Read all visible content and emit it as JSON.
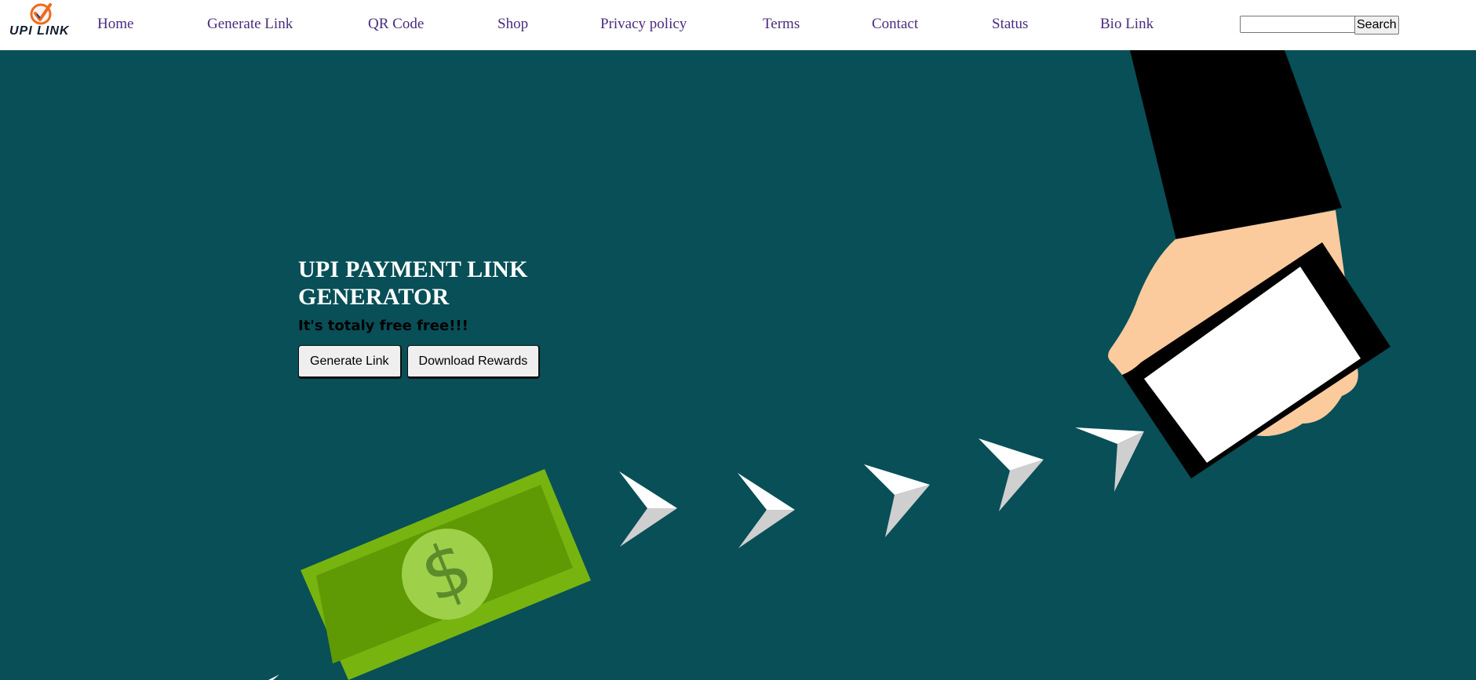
{
  "brand": {
    "logo_text": "UPI LINK"
  },
  "nav": {
    "items": [
      {
        "label": "Home"
      },
      {
        "label": "Generate Link"
      },
      {
        "label": "QR Code"
      },
      {
        "label": "Shop"
      },
      {
        "label": "Privacy policy"
      },
      {
        "label": "Terms"
      },
      {
        "label": "Contact"
      },
      {
        "label": "Status"
      },
      {
        "label": "Bio Link"
      }
    ],
    "search": {
      "value": "",
      "button_label": "Search"
    }
  },
  "hero": {
    "title": "UPI PAYMENT LINK GENERATOR",
    "subtitle": "It's totaly free free!!!",
    "buttons": [
      {
        "label": "Generate Link"
      },
      {
        "label": "Download Rewards"
      }
    ],
    "illustration_icons": [
      "dollar-bill-icon",
      "paper-plane-arrow-icon",
      "hand-holding-phone-icon"
    ]
  },
  "colors": {
    "hero_background": "#084f57",
    "nav_link": "#4b2b7f",
    "banknote": "#78b410",
    "logo_accent": "#ef6a1b"
  }
}
